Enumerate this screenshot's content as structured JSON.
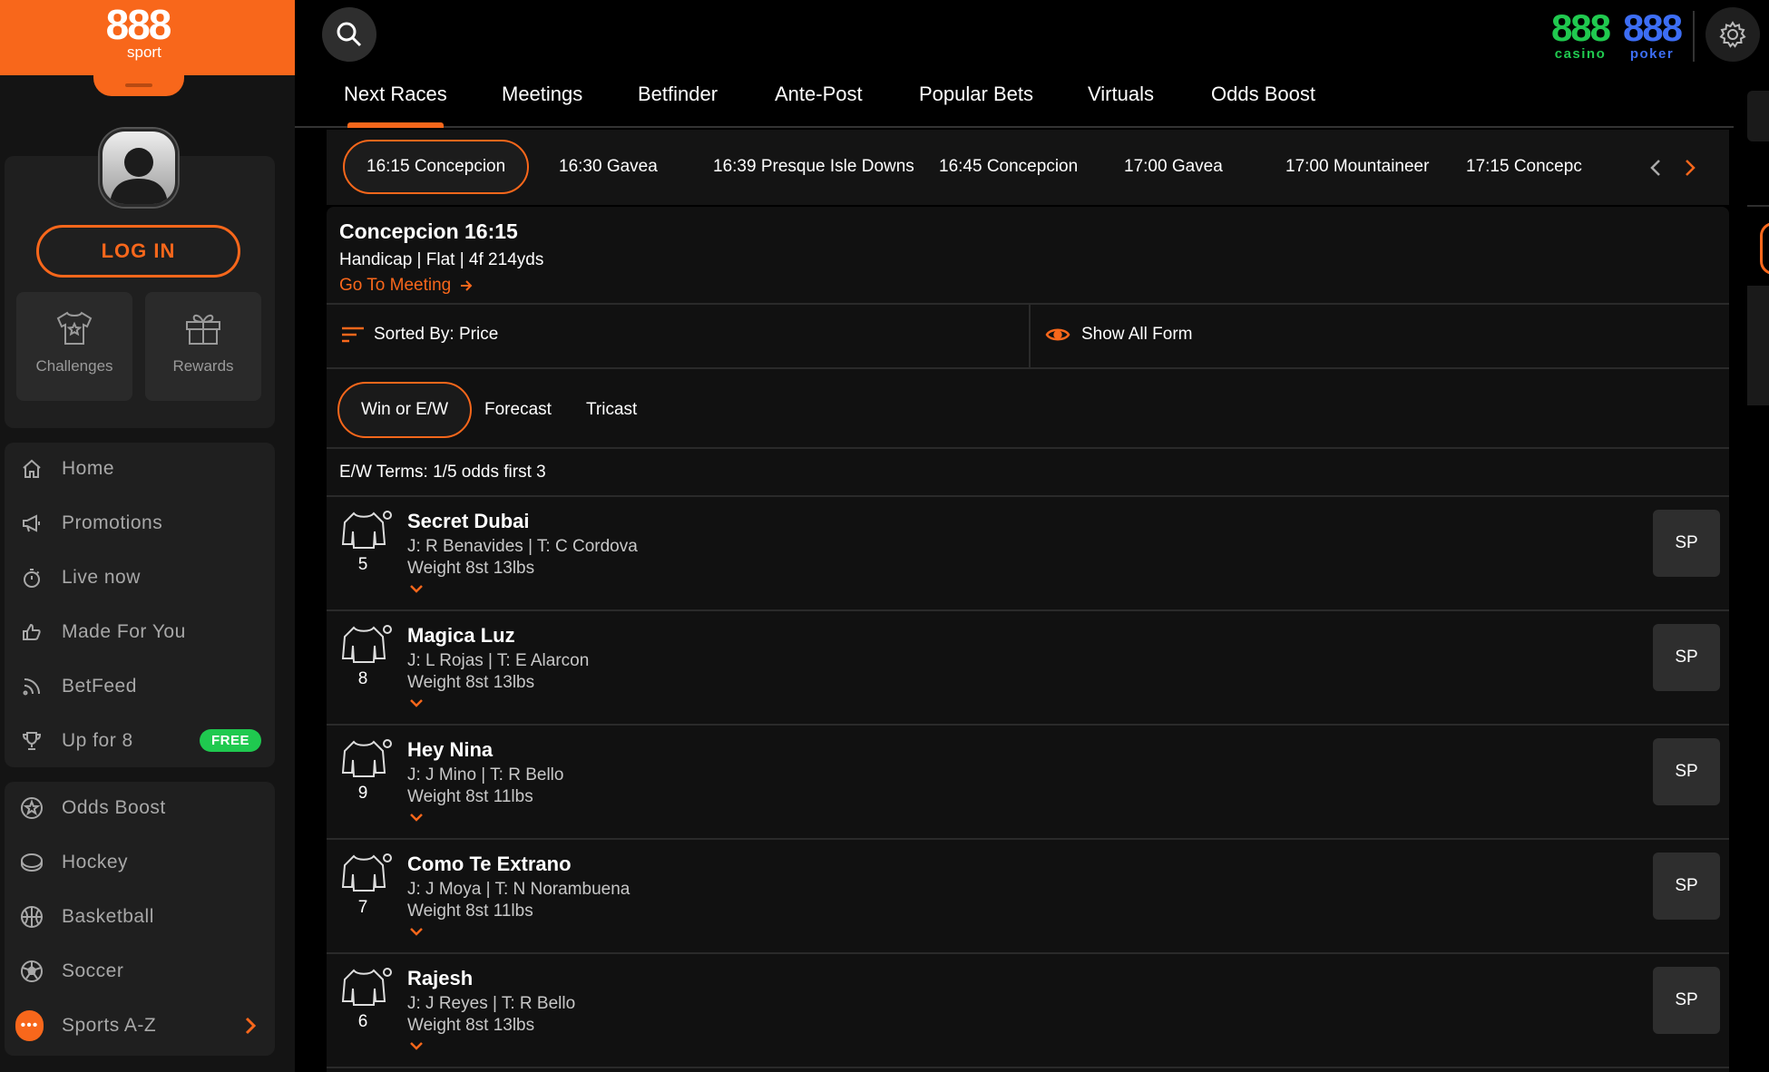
{
  "brand": {
    "logo_number": "888",
    "logo_word": "sport",
    "accent": "#f8671b"
  },
  "user": {
    "login_label": "LOG IN"
  },
  "tiles": [
    {
      "label": "Challenges",
      "icon": "shirt-star-icon"
    },
    {
      "label": "Rewards",
      "icon": "gift-icon"
    }
  ],
  "nav_main": [
    {
      "label": "Home",
      "icon": "home-icon"
    },
    {
      "label": "Promotions",
      "icon": "megaphone-icon"
    },
    {
      "label": "Live now",
      "icon": "stopwatch-icon"
    },
    {
      "label": "Made For You",
      "icon": "thumbs-up-icon"
    },
    {
      "label": "BetFeed",
      "icon": "rss-icon"
    },
    {
      "label": "Up for 8",
      "icon": "trophy-icon",
      "badge": "FREE"
    }
  ],
  "nav_sports": [
    {
      "label": "Odds Boost",
      "icon": "odds-boost-icon"
    },
    {
      "label": "Hockey",
      "icon": "hockey-puck-icon"
    },
    {
      "label": "Basketball",
      "icon": "basketball-icon"
    },
    {
      "label": "Soccer",
      "icon": "soccer-ball-icon"
    },
    {
      "label": "Sports A-Z",
      "icon": "more-dots-icon"
    }
  ],
  "cross_brands": [
    {
      "number": "888",
      "word": "casino",
      "color": "#20c94f"
    },
    {
      "number": "888",
      "word": "poker",
      "color": "#3d6ef5"
    }
  ],
  "tabs": [
    "Next Races",
    "Meetings",
    "Betfinder",
    "Ante-Post",
    "Popular Bets",
    "Virtuals",
    "Odds Boost"
  ],
  "active_tab": "Next Races",
  "races": [
    "16:15 Concepcion",
    "16:30 Gavea",
    "16:39 Presque Isle Downs",
    "16:45 Concepcion",
    "17:00 Gavea",
    "17:00 Mountaineer",
    "17:15 Concepc"
  ],
  "active_race": "16:15 Concepcion",
  "race": {
    "title": "Concepcion 16:15",
    "details": "Handicap | Flat | 4f 214yds",
    "meeting_link": "Go To Meeting"
  },
  "sort": {
    "label": "Sorted By: Price"
  },
  "form": {
    "label": "Show All Form"
  },
  "bet_types": [
    "Win or E/W",
    "Forecast",
    "Tricast"
  ],
  "active_bet_type": "Win or E/W",
  "ew_terms": "E/W Terms: 1/5 odds first 3",
  "runners": [
    {
      "number": "5",
      "name": "Secret Dubai",
      "jockey_trainer": "J: R Benavides | T: C Cordova",
      "weight": "Weight 8st 13lbs",
      "price": "SP"
    },
    {
      "number": "8",
      "name": "Magica Luz",
      "jockey_trainer": "J: L Rojas | T: E Alarcon",
      "weight": "Weight 8st 13lbs",
      "price": "SP"
    },
    {
      "number": "9",
      "name": "Hey Nina",
      "jockey_trainer": "J: J Mino | T: R Bello",
      "weight": "Weight 8st 11lbs",
      "price": "SP"
    },
    {
      "number": "7",
      "name": "Como Te Extrano",
      "jockey_trainer": "J: J Moya | T: N Norambuena",
      "weight": "Weight 8st 11lbs",
      "price": "SP"
    },
    {
      "number": "6",
      "name": "Rajesh",
      "jockey_trainer": "J: J Reyes | T: R Bello",
      "weight": "Weight 8st 13lbs",
      "price": "SP"
    }
  ]
}
